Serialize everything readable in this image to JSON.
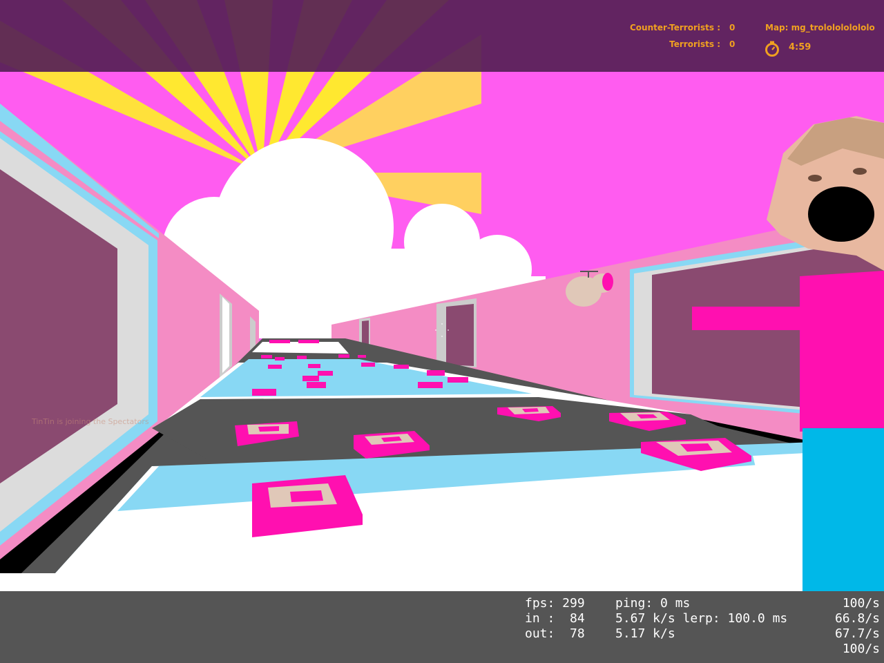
{
  "game": "Counter-Strike",
  "hud": {
    "ct_label": "Counter-Terrorists :",
    "ct_score": "0",
    "t_label": "Terrorists :",
    "t_score": "0",
    "map_label": "Map: mg_trololololololo",
    "timer": "4:59",
    "timer_icon": "stopwatch-icon",
    "accent_color": "#f0a020"
  },
  "messages": {
    "join": "TinTin is joining the Spectators"
  },
  "netgraph": {
    "fps": "fps: 299",
    "ping": "ping: 0 ms",
    "in": "in :  84",
    "in_rate": "5.67 k/s lerp: 100.0 ms",
    "out": "out:  78",
    "out_rate": "5.17 k/s",
    "right_1": "100/s",
    "right_2": "66.8/s",
    "right_3": "67.7/s",
    "right_4": "100/s"
  },
  "colors": {
    "sky_pink": "#ff5cf0",
    "wall_pink": "#f48cc4",
    "floor_blue": "#88d8f4",
    "floor_dark": "#555555",
    "floor_white": "#ffffff",
    "block_magenta": "#ff10b0",
    "block_beige": "#e0c8b8",
    "sun_yellow": "#ffe830",
    "bar_purple": "#562056"
  }
}
